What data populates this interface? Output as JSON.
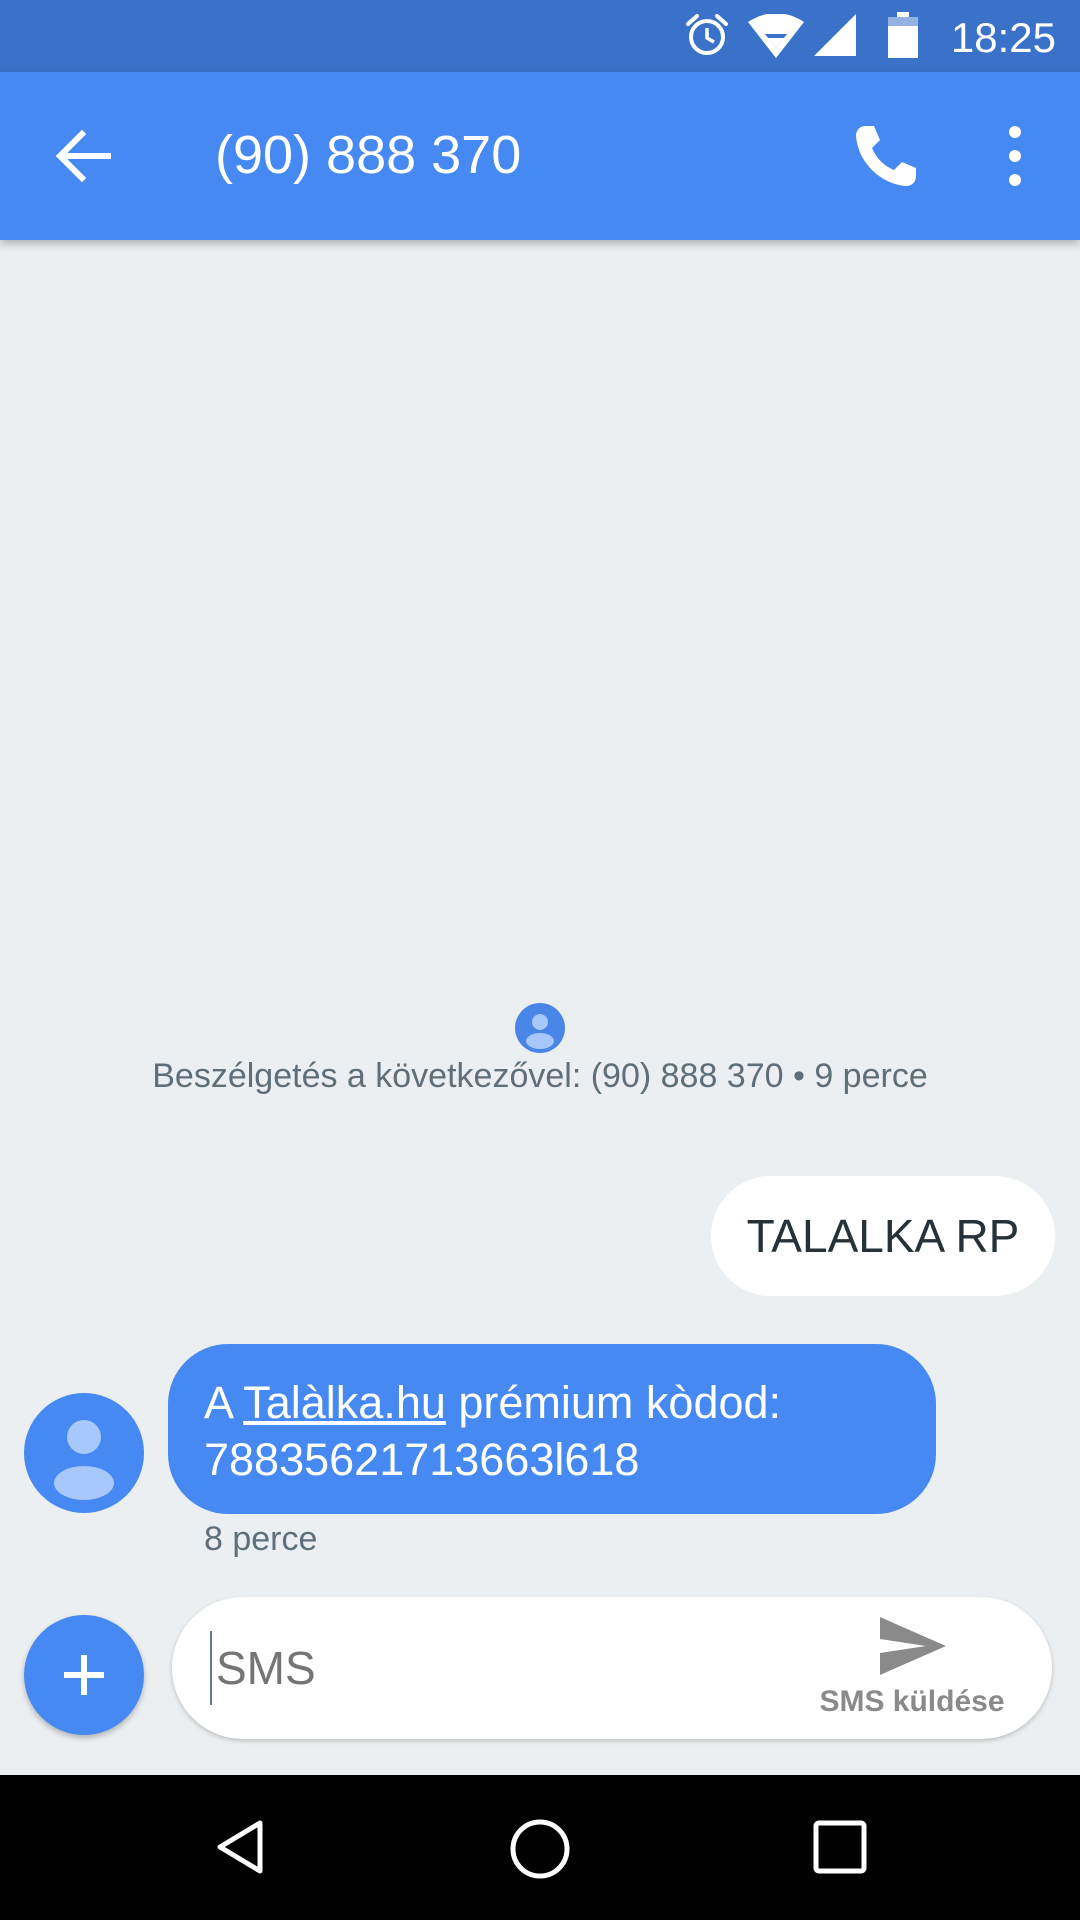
{
  "status_bar": {
    "time": "18:25",
    "icons": [
      "alarm-icon",
      "wifi-icon",
      "cell-signal-icon",
      "battery-icon"
    ]
  },
  "app_bar": {
    "title": "(90) 888 370",
    "icons": [
      "back-arrow-icon",
      "phone-icon",
      "more-vert-icon"
    ]
  },
  "conversation": {
    "header": "Beszélgetés a következővel: (90) 888 370 • 9 perce",
    "messages": [
      {
        "direction": "outgoing",
        "text": "TALALKA RP"
      },
      {
        "direction": "incoming",
        "prefix": "A ",
        "link": "Talàlka.hu",
        "suffix": " prémium kòdod:",
        "code": "78835621713663l618",
        "time": "8 perce"
      }
    ]
  },
  "compose": {
    "placeholder": "SMS",
    "send_label": "SMS küldése"
  },
  "nav_bar": {
    "icons": [
      "back-triangle-icon",
      "home-circle-icon",
      "recents-square-icon"
    ]
  },
  "colors": {
    "status_bar": "#3b72c9",
    "app_bar": "#4689f2",
    "background": "#eceff1",
    "incoming_bubble": "#4689f2",
    "outgoing_bubble": "#ffffff"
  }
}
